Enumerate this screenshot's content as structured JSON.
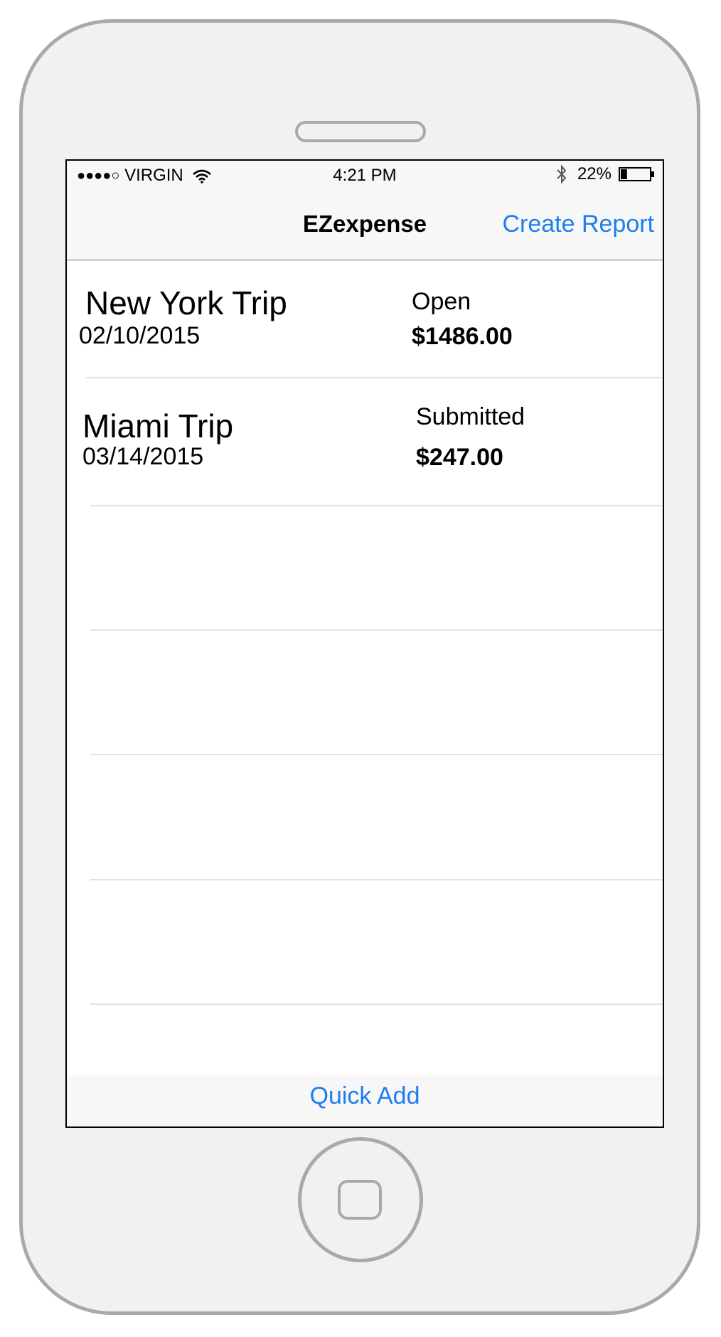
{
  "status_bar": {
    "signal": "●●●●○",
    "carrier": "VIRGIN",
    "time": "4:21 PM",
    "battery_percent": "22%",
    "battery_level": 0.22
  },
  "nav": {
    "title": "EZexpense",
    "action_label": "Create Report"
  },
  "reports": [
    {
      "name": "New York Trip",
      "date": "02/10/2015",
      "status": "Open",
      "amount": "$1486.00"
    },
    {
      "name": "Miami Trip",
      "date": "03/14/2015",
      "status": "Submitted",
      "amount": "$247.00"
    }
  ],
  "toolbar": {
    "quick_add_label": "Quick Add"
  },
  "colors": {
    "accent": "#1f7df0",
    "frame": "#a9a9a9",
    "bar_bg": "#f7f7f7"
  },
  "icons": [
    "signal-dots-icon",
    "wifi-icon",
    "bluetooth-icon",
    "battery-icon",
    "home-button-icon"
  ]
}
